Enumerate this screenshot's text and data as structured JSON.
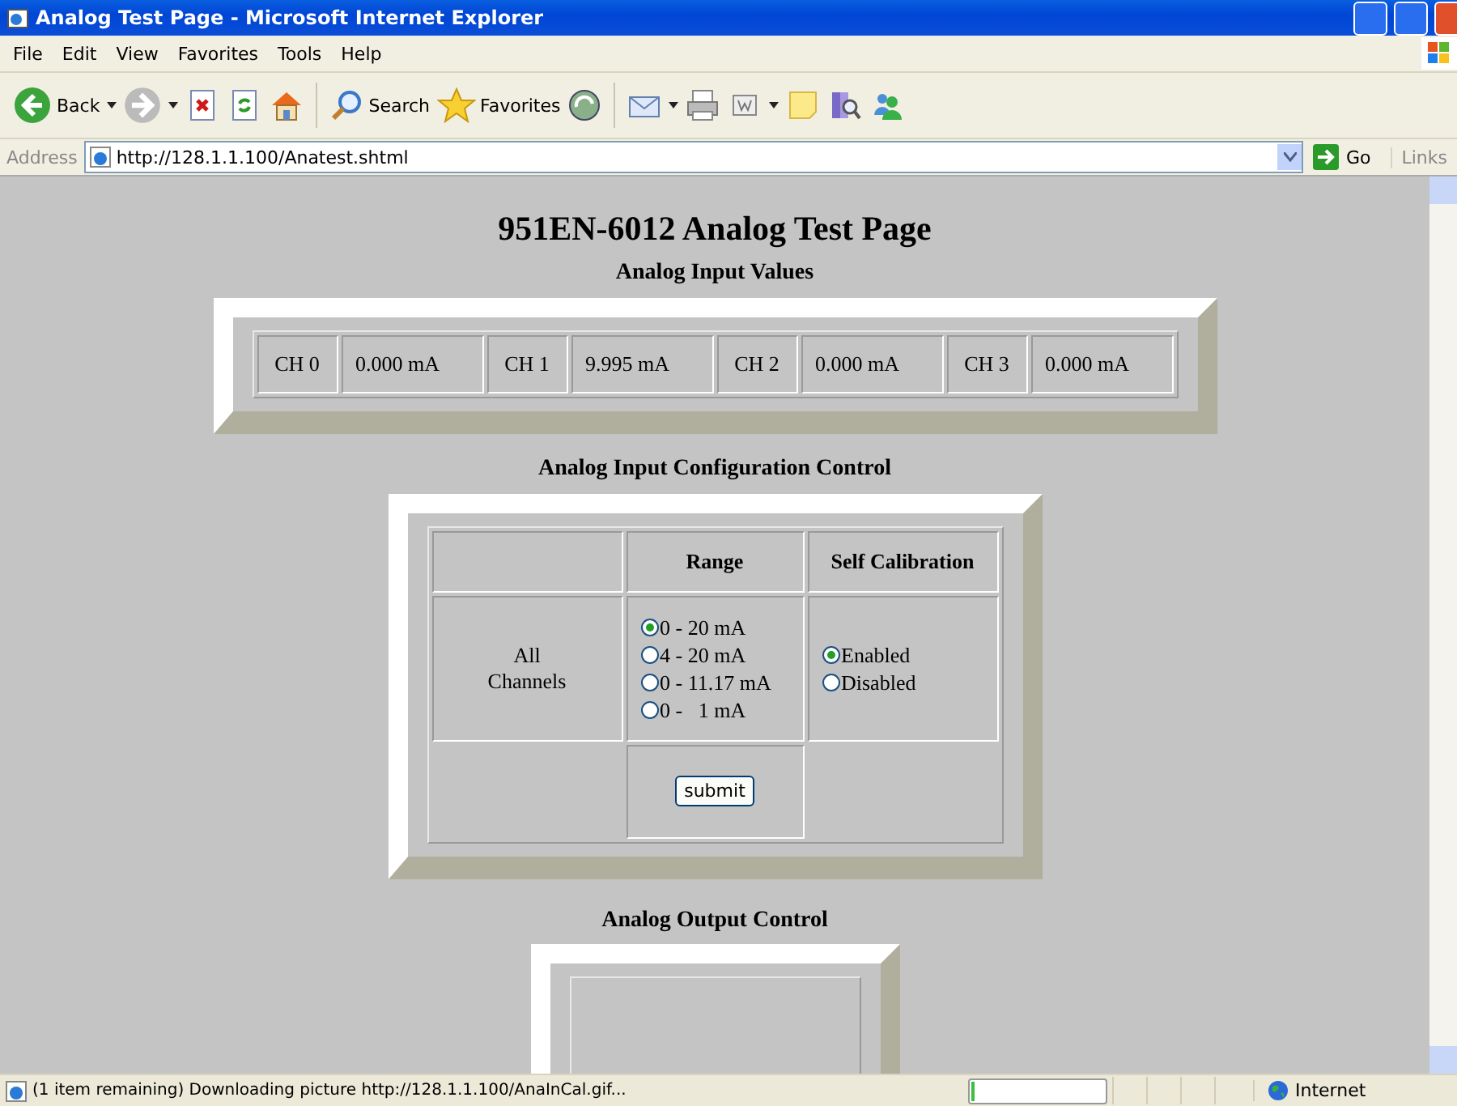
{
  "window": {
    "title": "Analog Test Page - Microsoft Internet Explorer"
  },
  "menu": [
    "File",
    "Edit",
    "View",
    "Favorites",
    "Tools",
    "Help"
  ],
  "toolbar": {
    "back": "Back",
    "search": "Search",
    "favorites": "Favorites"
  },
  "address_bar": {
    "label": "Address",
    "value": "http://128.1.1.100/Anatest.shtml",
    "go": "Go",
    "links": "Links"
  },
  "page": {
    "title": "951EN-6012 Analog Test Page",
    "input_heading": "Analog Input Values",
    "inputs": [
      {
        "channel": "CH 0",
        "value": "0.000 mA"
      },
      {
        "channel": "CH 1",
        "value": "9.995 mA"
      },
      {
        "channel": "CH 2",
        "value": "0.000 mA"
      },
      {
        "channel": "CH 3",
        "value": "0.000 mA"
      }
    ],
    "config_heading": "Analog Input Configuration Control",
    "config": {
      "columns": [
        "Range",
        "Self Calibration"
      ],
      "row_label": "All Channels",
      "ranges": [
        {
          "label": "0 - 20 mA",
          "selected": true
        },
        {
          "label": "4 - 20 mA",
          "selected": false
        },
        {
          "label": "0 - 11.17 mA",
          "selected": false
        },
        {
          "label": "0 -   1 mA",
          "selected": false
        }
      ],
      "calibration": [
        {
          "label": "Enabled",
          "selected": true
        },
        {
          "label": "Disabled",
          "selected": false
        }
      ],
      "submit": "submit"
    },
    "output_heading": "Analog Output Control"
  },
  "status_bar": {
    "text": "(1 item remaining) Downloading picture http://128.1.1.100/AnaInCal.gif...",
    "level": 0.03,
    "zone": "Internet"
  }
}
